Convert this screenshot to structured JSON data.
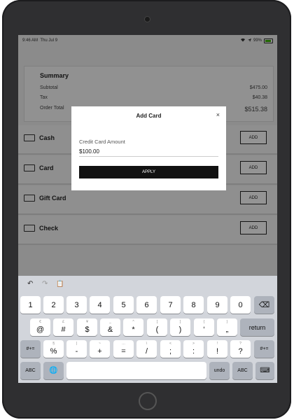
{
  "status": {
    "time": "9:46 AM",
    "date": "Thu Jul 9",
    "battery": "99%"
  },
  "summary": {
    "title": "Summary",
    "rows": [
      {
        "label": "Subtotal",
        "value": "$475.00"
      },
      {
        "label": "Tax",
        "value": "$40.38"
      },
      {
        "label": "Order Total",
        "value": "$515.38"
      }
    ]
  },
  "payments": [
    {
      "label": "Cash",
      "button": "ADD",
      "icon": "cash-icon"
    },
    {
      "label": "Card",
      "button": "ADD",
      "icon": "card-icon"
    },
    {
      "label": "Gift Card",
      "button": "ADD",
      "icon": "gift-card-icon"
    },
    {
      "label": "Check",
      "button": "ADD",
      "icon": "check-icon"
    }
  ],
  "modal": {
    "title": "Add Card",
    "close": "×",
    "field_label": "Credit Card Amount",
    "field_value": "$100.00",
    "apply": "APPLY"
  },
  "keyboard": {
    "toolbar": {
      "undo_icon": "↶",
      "redo_icon": "↷",
      "paste_icon": "📋"
    },
    "row1": [
      "1",
      "2",
      "3",
      "4",
      "5",
      "6",
      "7",
      "8",
      "9",
      "0"
    ],
    "row1_delete": "⌫",
    "row2": [
      {
        "sup": "€",
        "key": "@"
      },
      {
        "sup": "£",
        "key": "#"
      },
      {
        "sup": "¥",
        "key": "$"
      },
      {
        "sup": "_",
        "key": "&"
      },
      {
        "sup": "^",
        "key": "*"
      },
      {
        "sup": "[",
        "key": "("
      },
      {
        "sup": "]",
        "key": ")"
      },
      {
        "sup": "{",
        "key": "‘"
      },
      {
        "sup": "}",
        "key": "„"
      }
    ],
    "row2_return": "return",
    "row3_left": "#+=",
    "row3": [
      {
        "sup": "§",
        "key": "%"
      },
      {
        "sup": "|",
        "key": "-"
      },
      {
        "sup": "~",
        "key": "+"
      },
      {
        "sup": "…",
        "key": "="
      },
      {
        "sup": "\\",
        "key": "/"
      },
      {
        "sup": "<",
        "key": ";"
      },
      {
        "sup": ">",
        "key": ":"
      },
      {
        "sup": "!",
        "key": "!"
      },
      {
        "sup": "?",
        "key": "?"
      }
    ],
    "row3_right": "#+=",
    "row4": {
      "abc_left": "ABC",
      "globe": "🌐",
      "space": "",
      "undo": "undo",
      "abc_right": "ABC",
      "hide": "⌨"
    }
  }
}
